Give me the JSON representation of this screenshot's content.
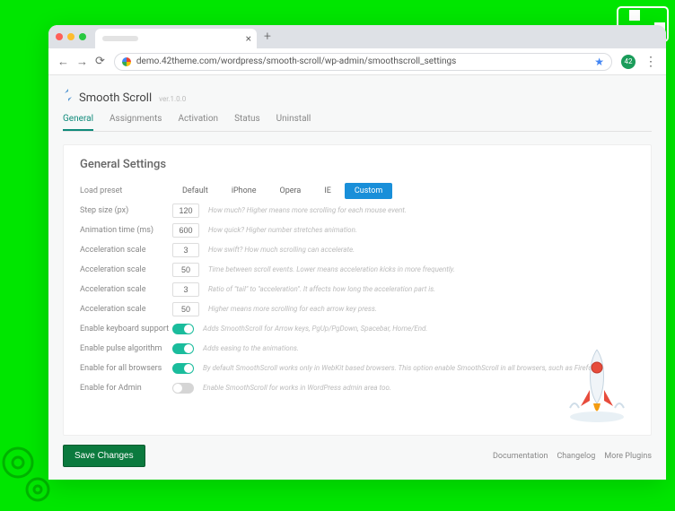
{
  "browser": {
    "url": "demo.42theme.com/wordpress/smooth-scroll/wp-admin/smoothscroll_settings",
    "avatar": "42"
  },
  "app": {
    "title": "Smooth Scroll",
    "version": "ver.1.0.0"
  },
  "tabs": [
    "General",
    "Assignments",
    "Activation",
    "Status",
    "Uninstall"
  ],
  "section_title": "General Settings",
  "preset_label": "Load preset",
  "presets": [
    "Default",
    "iPhone",
    "Opera",
    "IE",
    "Custom"
  ],
  "settings": [
    {
      "label": "Step size (px)",
      "value": "120",
      "type": "num",
      "hint": "How much? Higher means more scrolling for each mouse event."
    },
    {
      "label": "Animation time (ms)",
      "value": "600",
      "type": "num",
      "hint": "How quick? Higher number stretches animation."
    },
    {
      "label": "Acceleration scale",
      "value": "3",
      "type": "num",
      "hint": "How swift? How much scrolling can accelerate."
    },
    {
      "label": "Acceleration scale",
      "value": "50",
      "type": "num",
      "hint": "Time between scroll events. Lower means acceleration kicks in more frequently."
    },
    {
      "label": "Acceleration scale",
      "value": "3",
      "type": "num",
      "hint": "Ratio of \"tail\" to \"acceleration\". It affects how long the acceleration part is."
    },
    {
      "label": "Acceleration scale",
      "value": "50",
      "type": "num",
      "hint": "Higher means more scrolling for each arrow key press."
    },
    {
      "label": "Enable keyboard support",
      "value": "on",
      "type": "toggle",
      "hint": "Adds SmoothScroll for Arrow keys, PgUp/PgDown, Spacebar, Home/End."
    },
    {
      "label": "Enable pulse algorithm",
      "value": "on",
      "type": "toggle",
      "hint": "Adds easing to the animations."
    },
    {
      "label": "Enable for all browsers",
      "value": "on",
      "type": "toggle",
      "hint": "By default SmoothScroll works only in WebKit based browsers. This option enable SmoothScroll in all browsers, such as Firefox."
    },
    {
      "label": "Enable for Admin",
      "value": "off",
      "type": "toggle",
      "hint": "Enable SmoothScroll for works in WordPress admin area too."
    }
  ],
  "save": "Save Changes",
  "footer_links": [
    "Documentation",
    "Changelog",
    "More Plugins"
  ]
}
